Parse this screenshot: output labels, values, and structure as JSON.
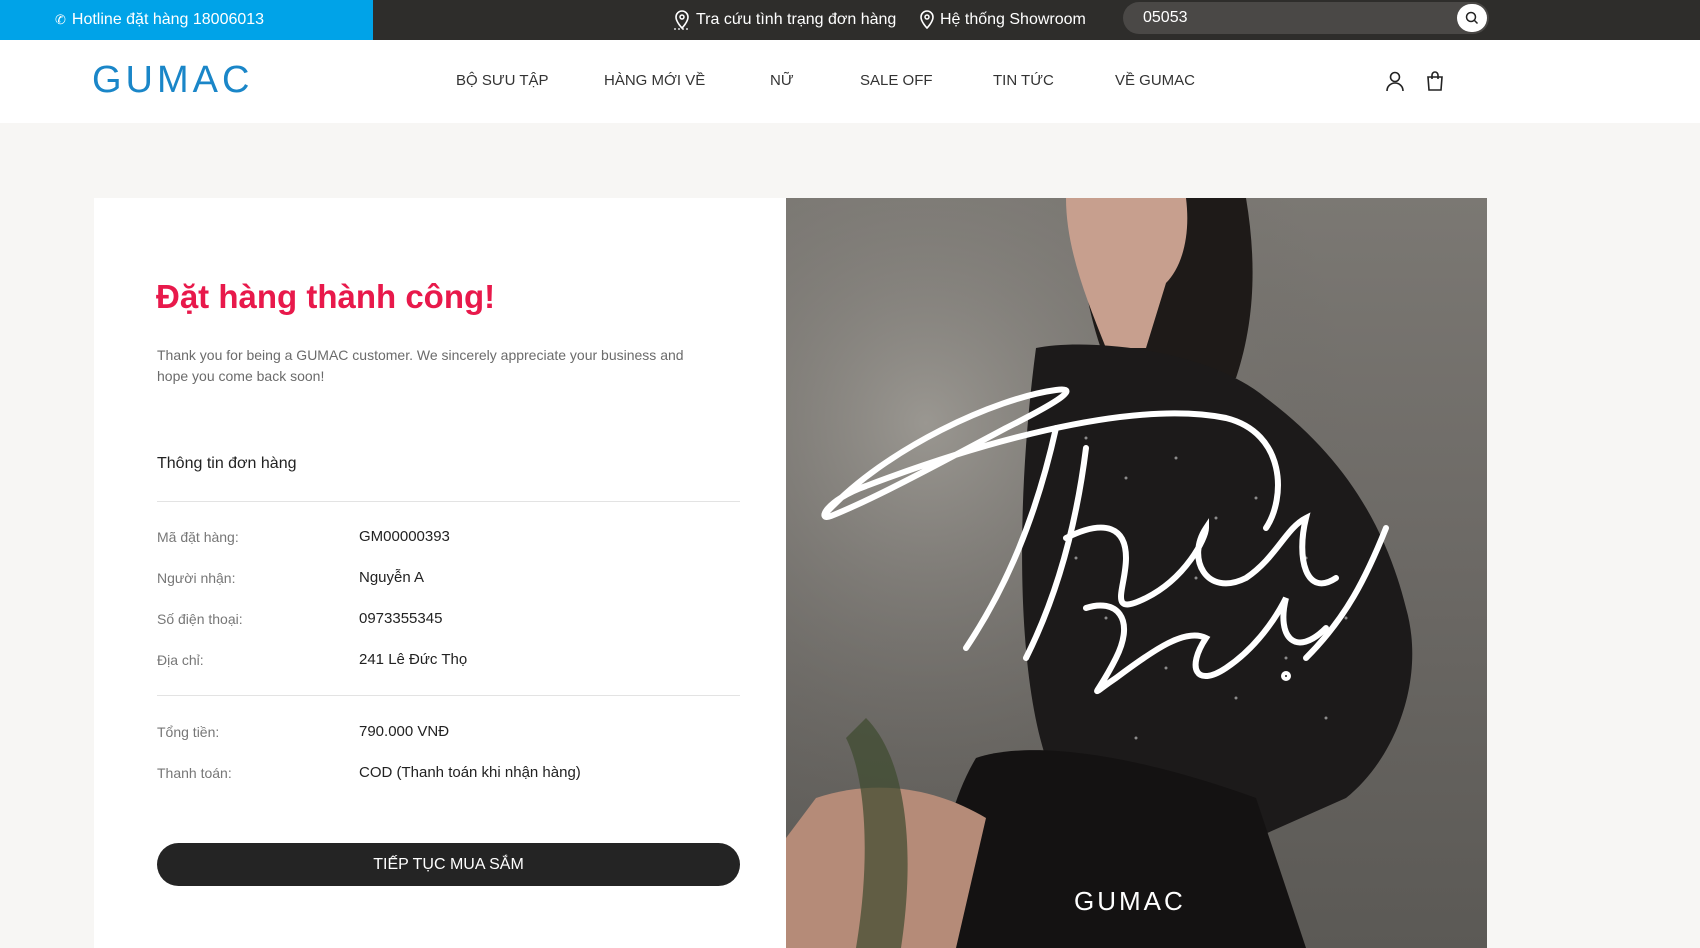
{
  "topbar": {
    "hotline": "Hotline đặt hàng 18006013",
    "order_lookup": "Tra cứu tình trạng đơn hàng",
    "showroom": "Hệ thống Showroom",
    "search_value": "05053"
  },
  "header": {
    "logo": "GUMAC",
    "nav": [
      "BỘ SƯU TẬP",
      "HÀNG MỚI VỀ",
      "NỮ",
      "SALE OFF",
      "TIN TỨC",
      "VỀ GUMAC"
    ]
  },
  "confirmation": {
    "title": "Đặt hàng thành công!",
    "message": "Thank you for being a GUMAC customer. We sincerely appreciate your business and hope you come back soon!",
    "section_title": "Thông tin đơn hàng",
    "rows": [
      {
        "label": "Mã đặt hàng:",
        "value": "GM00000393"
      },
      {
        "label": "Người nhận:",
        "value": "Nguyễn A"
      },
      {
        "label": "Số điện thoại:",
        "value": "0973355345"
      },
      {
        "label": "Địa chỉ:",
        "value": "241 Lê Đức Thọ"
      }
    ],
    "payment_rows": [
      {
        "label": "Tổng tiền:",
        "value": "790.000 VNĐ"
      },
      {
        "label": "Thanh toán:",
        "value": "COD (Thanh toán khi nhận hàng)"
      }
    ],
    "cta": "TIẾP TỤC MUA SẮM"
  },
  "banner": {
    "brand": "GUMAC"
  }
}
